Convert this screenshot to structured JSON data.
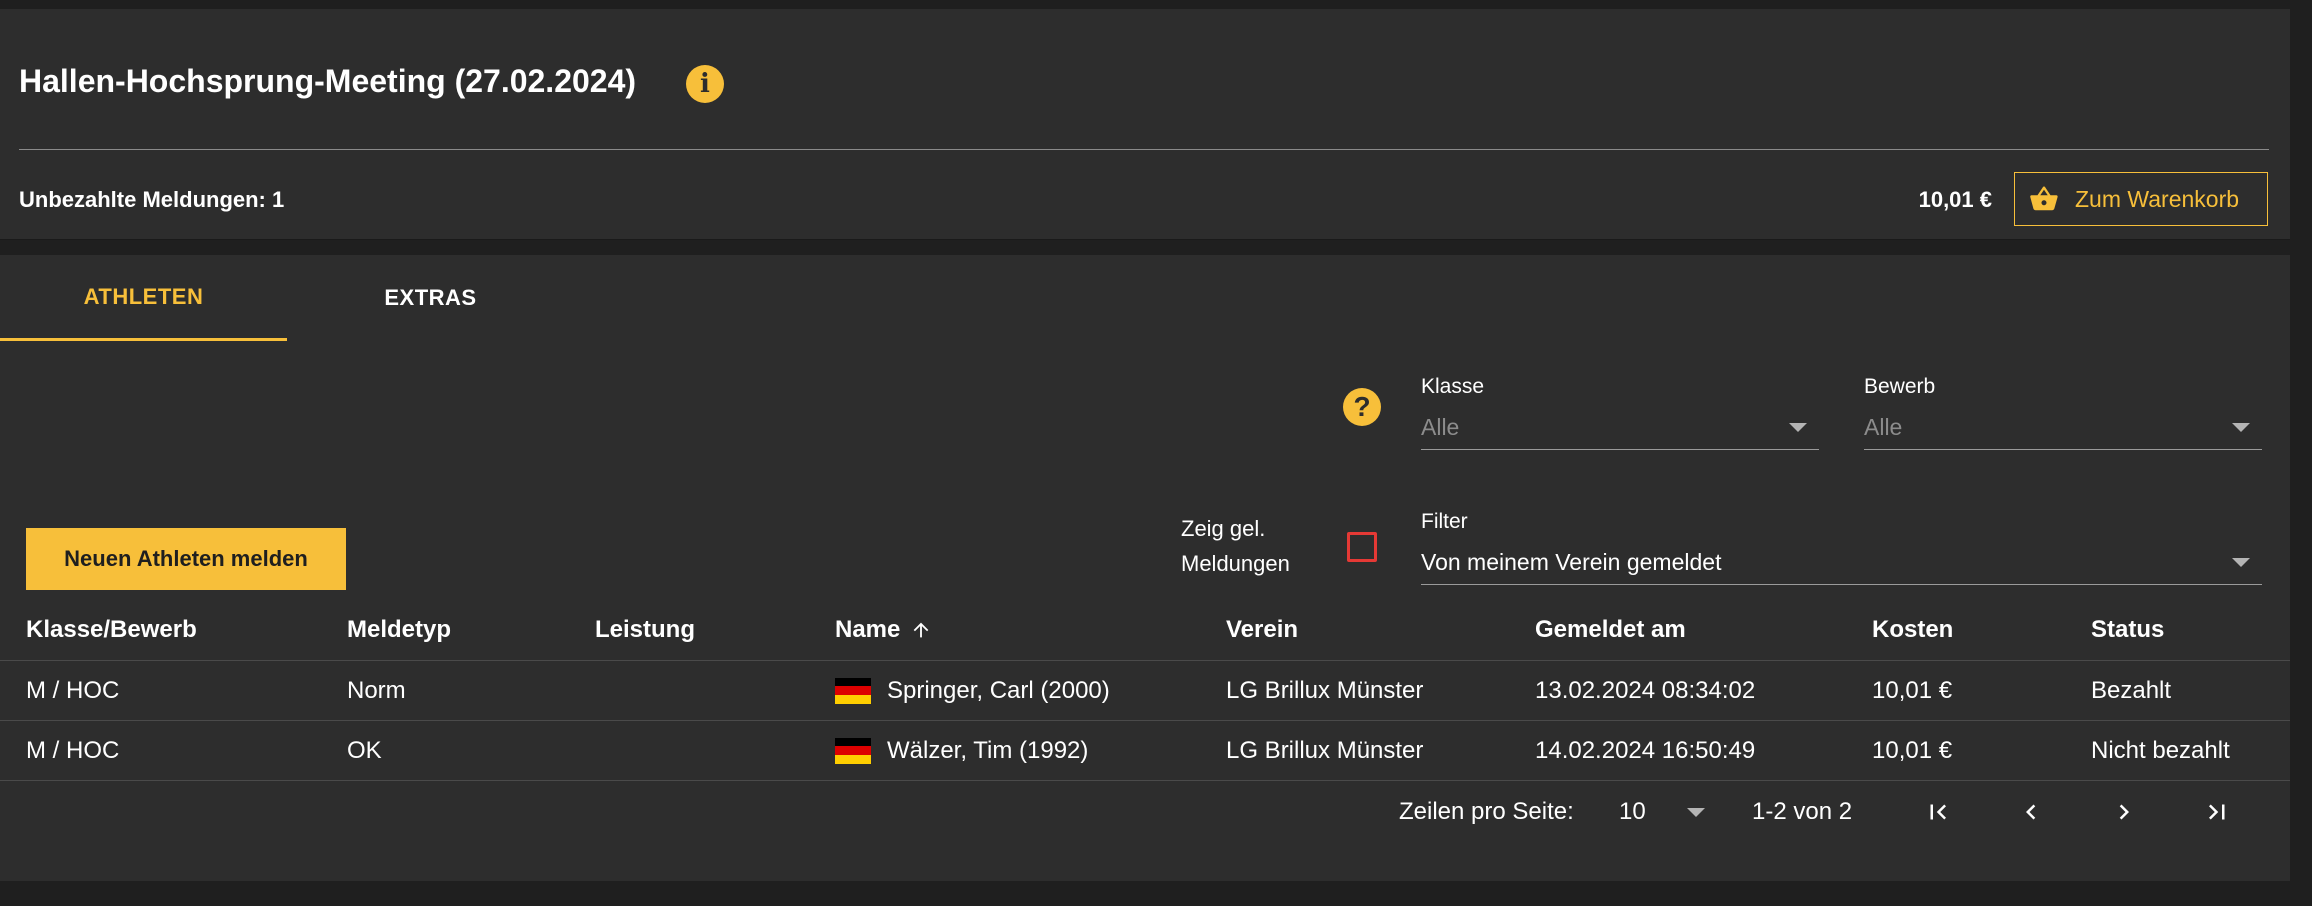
{
  "header": {
    "title": "Hallen-Hochsprung-Meeting (27.02.2024)",
    "unpaid_label": "Unbezahlte Meldungen: 1",
    "total": "10,01 €",
    "cart_button_label": "Zum Warenkorb",
    "info_icon": "info-icon"
  },
  "tabs": [
    {
      "label": "ATHLETEN",
      "active": true
    },
    {
      "label": "EXTRAS",
      "active": false
    }
  ],
  "filters": {
    "klasse_label": "Klasse",
    "klasse_value": "Alle",
    "bewerb_label": "Bewerb",
    "bewerb_value": "Alle",
    "filter_label": "Filter",
    "filter_value": "Von meinem Verein gemeldet",
    "show_label_line1": "Zeig gel.",
    "show_label_line2": "Meldungen"
  },
  "new_athlete_button": "Neuen Athleten melden",
  "table": {
    "columns": [
      "Klasse/Bewerb",
      "Meldetyp",
      "Leistung",
      "Name",
      "Verein",
      "Gemeldet am",
      "Kosten",
      "Status"
    ],
    "rows": [
      {
        "klasse": "M / HOC",
        "meldetyp": "Norm",
        "leistung": "",
        "name": "Springer, Carl (2000)",
        "verein": "LG Brillux Münster",
        "gemeldet": "13.02.2024 08:34:02",
        "kosten": "10,01 €",
        "status": "Bezahlt"
      },
      {
        "klasse": "M / HOC",
        "meldetyp": "OK",
        "leistung": "",
        "name": "Wälzer, Tim (1992)",
        "verein": "LG Brillux Münster",
        "gemeldet": "14.02.2024 16:50:49",
        "kosten": "10,01 €",
        "status": "Nicht bezahlt"
      }
    ]
  },
  "pagination": {
    "rows_per_page_label": "Zeilen pro Seite:",
    "rows_per_page": "10",
    "range": "1-2 von 2"
  },
  "colors": {
    "accent": "#f7bf3a",
    "card": "#2d2d2d",
    "background": "#1f1f1f",
    "checkbox_border": "#e53935"
  }
}
